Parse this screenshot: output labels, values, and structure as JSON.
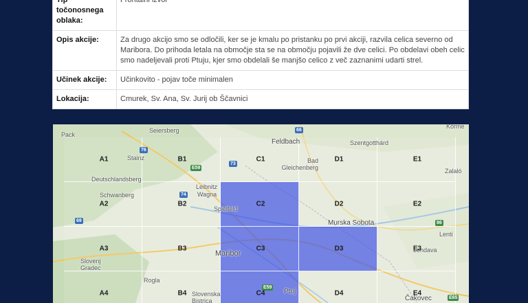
{
  "table": {
    "rows": [
      {
        "label": "Tip točonosnega oblaka:",
        "value": "Frontalni izvor"
      },
      {
        "label": "Opis akcije:",
        "value": "Za drugo akcijo smo se odločili, ker se je kmalu po pristanku po prvi akciji, razvila celica severno od Maribora. Do prihoda letala na območje sta se na območju pojavili že dve celici. Po obdelavi obeh celic smo nadeljevali proti Ptuju, kjer smo obdelali še manjšo celico z več zaznanimi udarti strel."
      },
      {
        "label": "Učinek akcije:",
        "value": "Učinkovito - pojav toče minimalen"
      },
      {
        "label": "Lokacija:",
        "value": "Cmurek, Sv. Ana, Sv. Jurij ob Ščavnici"
      }
    ]
  },
  "map": {
    "grid_labels": [
      "A1",
      "B1",
      "C1",
      "D1",
      "E1",
      "A2",
      "B2",
      "C2",
      "D2",
      "E2",
      "A3",
      "B3",
      "C3",
      "D3",
      "E3",
      "A4",
      "B4",
      "C4",
      "D4",
      "E4"
    ],
    "active_cells": [
      "C2",
      "C3",
      "D3",
      "C4"
    ],
    "places": [
      {
        "name": "Seiersberg"
      },
      {
        "name": "Pack"
      },
      {
        "name": "Feldbach"
      },
      {
        "name": "Szentgotthárd"
      },
      {
        "name": "Körme"
      },
      {
        "name": "Stainz"
      },
      {
        "name": "Bad Gleichenberg"
      },
      {
        "name": "Zalaló"
      },
      {
        "name": "Deutschlandsberg"
      },
      {
        "name": "Schwanberg"
      },
      {
        "name": "Leibnitz"
      },
      {
        "name": "Wagna"
      },
      {
        "name": "Spielfeld"
      },
      {
        "name": "Murska Sobota"
      },
      {
        "name": "Lenti"
      },
      {
        "name": "Maribor"
      },
      {
        "name": "Lendava"
      },
      {
        "name": "Slovenj Gradec"
      },
      {
        "name": "Rogla"
      },
      {
        "name": "Slovenska Bistrica"
      },
      {
        "name": "Ptuj"
      },
      {
        "name": "Čakovec"
      }
    ],
    "road_shields": [
      "66",
      "76",
      "E59",
      "73",
      "74",
      "69",
      "86",
      "E59",
      "E65"
    ],
    "colors": {
      "active_cell": "#4a5ae6",
      "background": "#0c1d46"
    }
  }
}
